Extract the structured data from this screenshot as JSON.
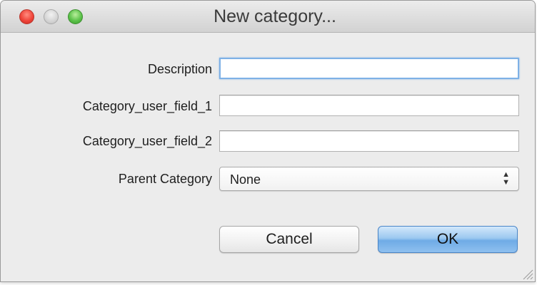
{
  "window": {
    "title": "New category...",
    "controls": {
      "close_icon": "close-icon",
      "minimize_icon": "minimize-icon",
      "zoom_icon": "zoom-icon"
    }
  },
  "form": {
    "description": {
      "label": "Description",
      "value": ""
    },
    "user_field_1": {
      "label": "Category_user_field_1",
      "value": ""
    },
    "user_field_2": {
      "label": "Category_user_field_2",
      "value": ""
    },
    "parent_category": {
      "label": "Parent Category",
      "selected": "None",
      "arrows_icon": "up-down-arrows-icon"
    }
  },
  "buttons": {
    "cancel_label": "Cancel",
    "ok_label": "OK"
  },
  "colors": {
    "focus_ring": "#7eb1e6",
    "default_button": "#6fabe6",
    "close": "#f0453a",
    "zoom": "#5cc24a"
  }
}
